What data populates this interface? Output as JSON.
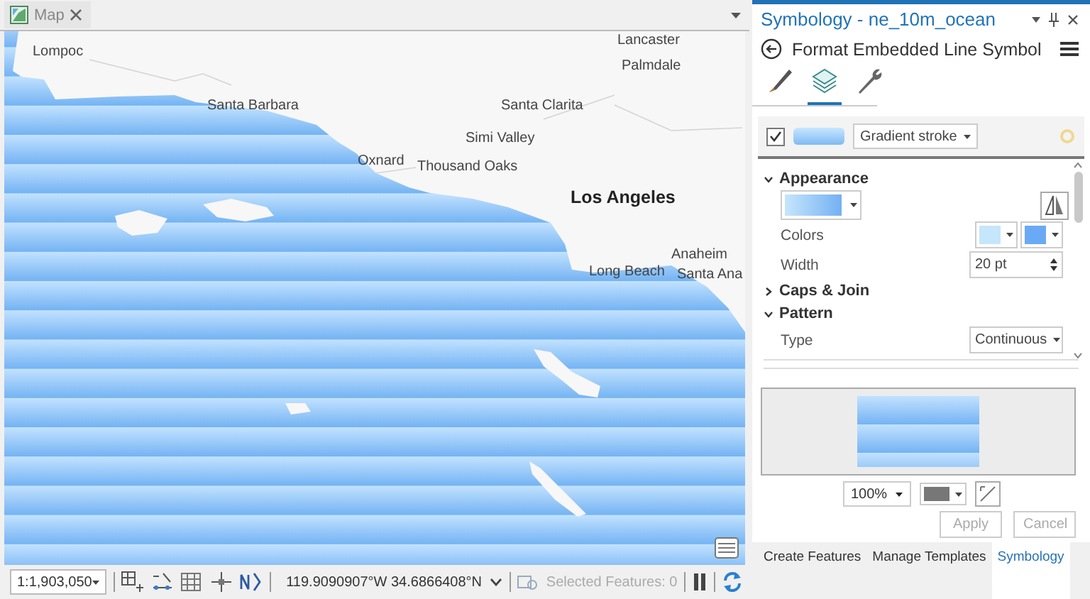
{
  "map_tab": {
    "label": "Map"
  },
  "map_labels": [
    {
      "text": "Lancaster",
      "kind": "city"
    },
    {
      "text": "Lompoc",
      "kind": "city"
    },
    {
      "text": "Palmdale",
      "kind": "city"
    },
    {
      "text": "Santa Barbara",
      "kind": "city"
    },
    {
      "text": "Santa Clarita",
      "kind": "city"
    },
    {
      "text": "Simi Valley",
      "kind": "city"
    },
    {
      "text": "Oxnard",
      "kind": "city"
    },
    {
      "text": "Thousand Oaks",
      "kind": "city"
    },
    {
      "text": "Los Angeles",
      "kind": "major"
    },
    {
      "text": "Anaheim",
      "kind": "city"
    },
    {
      "text": "Long Beach",
      "kind": "city"
    },
    {
      "text": "Santa Ana",
      "kind": "city"
    }
  ],
  "status_bar": {
    "scale": "1:1,903,050",
    "coordinates": "119.9090907°W 34.6866408°N",
    "selected_features": "Selected Features: 0"
  },
  "pane": {
    "title": "Symbology - ne_10m_ocean",
    "heading": "Format Embedded Line Symbol",
    "tool_tabs": [
      {
        "kind": "brush",
        "selected": false
      },
      {
        "kind": "layers",
        "selected": true
      },
      {
        "kind": "wrench",
        "selected": false
      }
    ],
    "layer": {
      "checked": true,
      "type": "Gradient stroke"
    },
    "sections": [
      {
        "title": "Appearance",
        "expanded": true,
        "rows": [
          {
            "kind": "gradient"
          },
          {
            "kind": "colors",
            "label": "Colors"
          },
          {
            "kind": "spin",
            "label": "Width",
            "value": "20 pt"
          }
        ]
      },
      {
        "title": "Caps & Join",
        "expanded": false
      },
      {
        "title": "Pattern",
        "expanded": true,
        "rows": [
          {
            "kind": "dropdown",
            "label": "Type",
            "value": "Continuous"
          }
        ]
      }
    ],
    "preview_zoom": "100%",
    "buttons": [
      {
        "label": "Apply",
        "disabled": true
      },
      {
        "label": "Cancel",
        "disabled": true
      }
    ]
  },
  "bottom_tabs": [
    {
      "label": "Create Features",
      "selected": false
    },
    {
      "label": "Manage Templates",
      "selected": false
    },
    {
      "label": "Symbology",
      "selected": true
    }
  ]
}
